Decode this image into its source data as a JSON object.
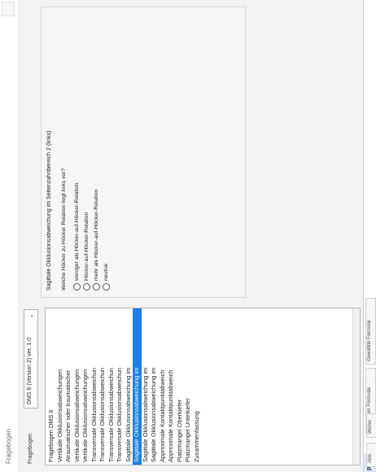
{
  "window": {
    "title": "Fragebogen"
  },
  "header": {
    "tab_label": "Fragebogen",
    "version_value": "DMS 6 (Version 2) ver. 1.0",
    "chevron_icon": "chevron-down-icon"
  },
  "tree": {
    "items": [
      "Fragebogen DMS 6",
      "Vertikale Okklusionsabweichungen",
      "Atraumatischer oder traumatischer",
      "Vertikale Okklusionsabweichungen",
      "Vertikale Okklusionsabweichungen",
      "Transversale Okklusionsabweichun",
      "Transversale Okklusionsabweichun",
      "Transversale Okklusionsabweichun",
      "Transversale Okklusionsabweichun",
      "Sagittale Okklusionsabweichung im",
      "Sagittale Okklusionsabweichung im",
      "Sagittale Okklusionsabweichung im",
      "Sagittale Okklusionsabweichung im",
      "Approximale Kontaktpunktabweich",
      "Approximale Kontaktpunktabweich",
      "Platzmangel Oberkiefer",
      "Platzmangel Unterkiefer",
      "Zusammenfassung"
    ],
    "selected_index": 10
  },
  "question": {
    "title": "Sagittale Okklusionsabweichung im Seitenzahnbereich 2 (links)",
    "prompt": "Welche Höcker zu Höcker Relation liegt links vor?",
    "options": [
      "weniger als Höcker-auf-Höcker-Relation",
      "Höcker-auf-Höcker-Relation",
      "mehr als Höcker-auf-Höcker-Relation",
      "neutral"
    ]
  },
  "bottom": {
    "label": "par",
    "buttons": [
      "Vorheriges Formular",
      "Gewählte Formular"
    ]
  },
  "side_tools": {
    "btn1": "Abb.",
    "btn2": "Weiter"
  }
}
